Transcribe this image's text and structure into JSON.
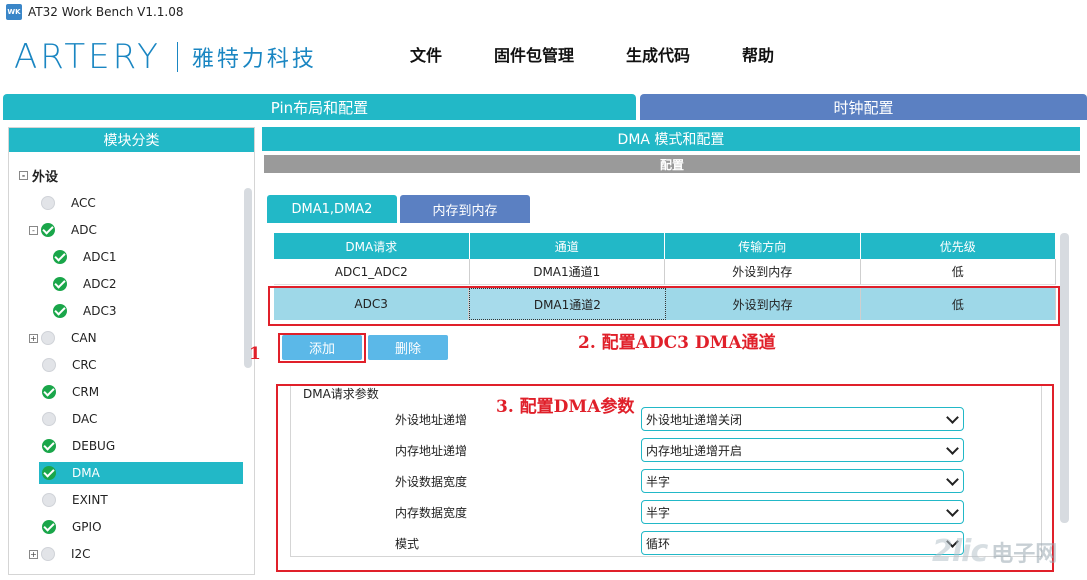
{
  "window": {
    "icon_text": "WK",
    "title": "AT32 Work Bench V1.1.08"
  },
  "header": {
    "logo_mark": "ARTERY",
    "logo_cn": "雅特力科技",
    "menu": [
      {
        "label": "文件"
      },
      {
        "label": "固件包管理"
      },
      {
        "label": "生成代码"
      },
      {
        "label": "帮助"
      }
    ]
  },
  "top_tabs": {
    "pin": "Pin布局和配置",
    "clock": "时钟配置"
  },
  "left_panel": {
    "title": "模块分类",
    "root": {
      "label": "外设",
      "expander": "-"
    },
    "items": [
      {
        "label": "ACC",
        "status": "empty"
      },
      {
        "label": "ADC",
        "status": "ok",
        "expander": "-"
      },
      {
        "label": "ADC1",
        "status": "ok"
      },
      {
        "label": "ADC2",
        "status": "ok"
      },
      {
        "label": "ADC3",
        "status": "ok"
      },
      {
        "label": "CAN",
        "status": "empty",
        "expander": "+"
      },
      {
        "label": "CRC",
        "status": "empty"
      },
      {
        "label": "CRM",
        "status": "ok"
      },
      {
        "label": "DAC",
        "status": "empty"
      },
      {
        "label": "DEBUG",
        "status": "ok"
      },
      {
        "label": "DMA",
        "status": "ok",
        "selected": true
      },
      {
        "label": "EXINT",
        "status": "empty"
      },
      {
        "label": "GPIO",
        "status": "ok"
      },
      {
        "label": "I2C",
        "status": "empty",
        "expander": "+"
      }
    ]
  },
  "right_panel": {
    "title": "DMA 模式和配置",
    "config_bar": "配置",
    "sub_tabs": {
      "dma": "DMA1,DMA2",
      "mem": "内存到内存"
    },
    "grid": {
      "headers": [
        "DMA请求",
        "通道",
        "传输方向",
        "优先级"
      ],
      "rows": [
        [
          "ADC1_ADC2",
          "DMA1通道1",
          "外设到内存",
          "低"
        ],
        [
          "ADC3",
          "DMA1通道2",
          "外设到内存",
          "低"
        ]
      ]
    },
    "buttons": {
      "add": "添加",
      "delete": "删除"
    },
    "params": {
      "title": "DMA请求参数",
      "rows": [
        {
          "label": "外设地址递增",
          "value": "外设地址递增关闭"
        },
        {
          "label": "内存地址递增",
          "value": "内存地址递增开启"
        },
        {
          "label": "外设数据宽度",
          "value": "半字"
        },
        {
          "label": "内存数据宽度",
          "value": "半字"
        },
        {
          "label": "模式",
          "value": "循环"
        }
      ]
    }
  },
  "annotations": {
    "step1": "1",
    "step2": "2. 配置ADC3  DMA通道",
    "step3": "3. 配置DMA参数",
    "color": "#e0202a"
  },
  "watermark": {
    "logo": "2lic",
    "text": "电子网"
  },
  "colors": {
    "teal": "#22b8c7",
    "blue": "#5b80c2",
    "button": "#5bb8e8",
    "selected_row": "#9ed8e8"
  }
}
